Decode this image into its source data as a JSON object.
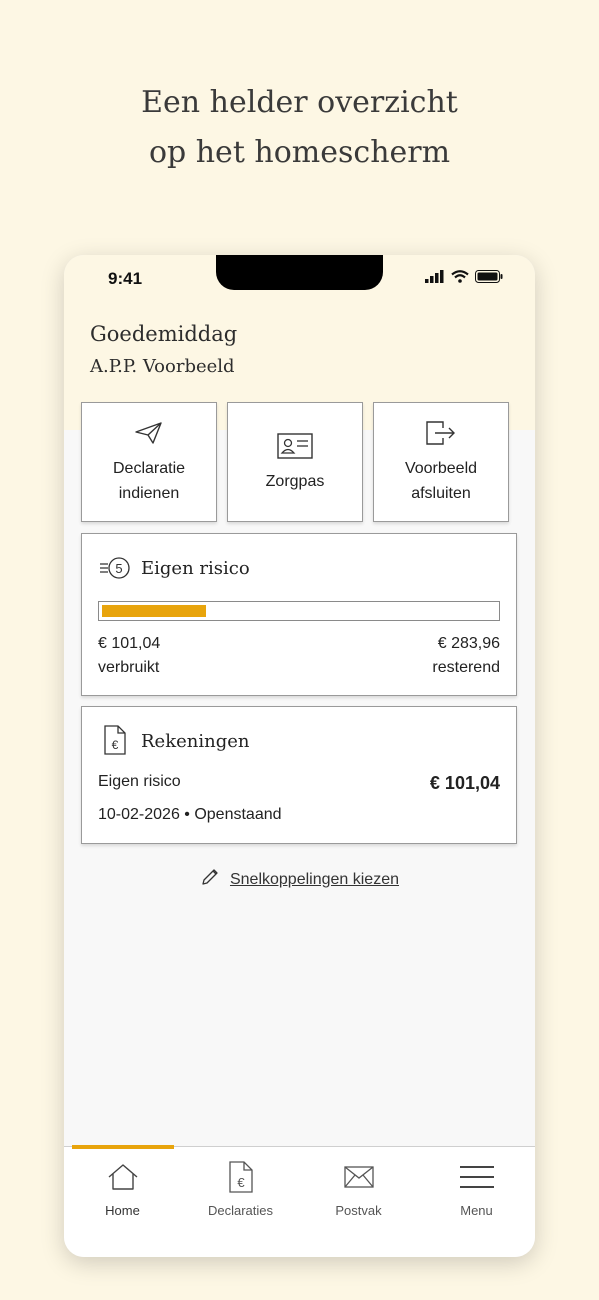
{
  "headline": {
    "line1": "Een helder overzicht",
    "line2": "op het homescherm"
  },
  "status_bar": {
    "time": "9:41"
  },
  "greeting": {
    "title": "Goedemiddag",
    "name": "A.P.P. Voorbeeld"
  },
  "quick_actions": [
    {
      "label": "Declaratie indienen",
      "icon": "paper-plane-icon"
    },
    {
      "label": "Zorgpas",
      "icon": "id-card-icon"
    },
    {
      "label": "Voorbeeld afsluiten",
      "icon": "exit-icon"
    }
  ],
  "eigen_risico": {
    "title": "Eigen risico",
    "icon": "coins-5-icon",
    "used_amount": "€ 101,04",
    "used_label": "verbruikt",
    "remaining_amount": "€ 283,96",
    "remaining_label": "resterend",
    "progress_fraction": 0.263,
    "progress_color": "#e8a40c"
  },
  "rekeningen": {
    "title": "Rekeningen",
    "icon": "euro-document-icon",
    "item_label": "Eigen risico",
    "item_amount": "€ 101,04",
    "item_meta": "10-02-2026 • Openstaand"
  },
  "shortcuts_link": {
    "label": "Snelkoppelingen kiezen",
    "icon": "pencil-icon"
  },
  "tabbar": {
    "active_color": "#e8a40c",
    "tabs": [
      {
        "label": "Home",
        "icon": "home-icon",
        "active": true
      },
      {
        "label": "Declaraties",
        "icon": "euro-document-icon",
        "active": false
      },
      {
        "label": "Postvak",
        "icon": "envelope-icon",
        "active": false
      },
      {
        "label": "Menu",
        "icon": "hamburger-menu-icon",
        "active": false
      }
    ]
  }
}
